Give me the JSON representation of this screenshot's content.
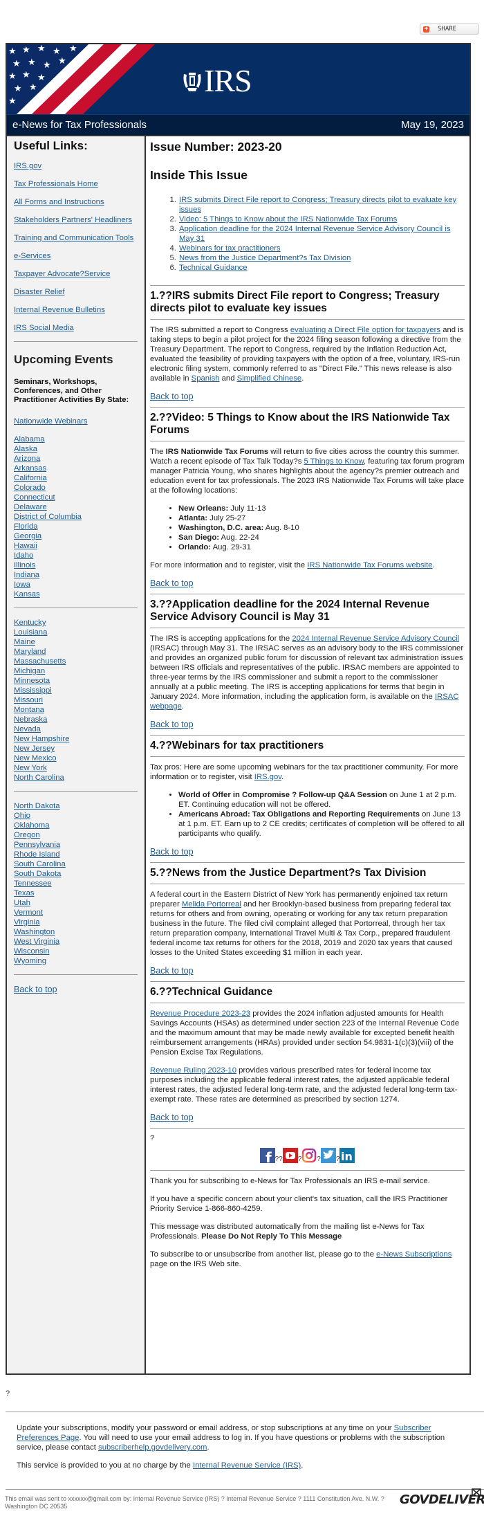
{
  "share": {
    "label": "SHARE"
  },
  "header": {
    "logo_text": "IRS",
    "newsletter_title": "e-News for Tax Professionals",
    "date": "May 19, 2023"
  },
  "sidebar": {
    "useful_links_heading": "Useful Links:",
    "useful_links": [
      {
        "label": "IRS.gov"
      },
      {
        "label": "Tax Professionals Home"
      },
      {
        "label": "All Forms and Instructions"
      },
      {
        "label": "Stakeholders Partners' Headliners"
      },
      {
        "label": "Training and Communication Tools"
      },
      {
        "label": "e-Services"
      },
      {
        "label": "Taxpayer Advocate?Service"
      },
      {
        "label": "Disaster Relief"
      },
      {
        "label": "Internal Revenue Bulletins"
      },
      {
        "label": "IRS Social Media"
      }
    ],
    "events_heading": "Upcoming Events",
    "events_subheading": "Seminars, Workshops, Conferences, and Other Practitioner Activities By State:",
    "nationwide_label": "Nationwide Webinars",
    "states_group_1": [
      "Alabama",
      "Alaska",
      "Arizona",
      "Arkansas",
      "California",
      "Colorado",
      "Connecticut",
      "Delaware",
      "District of Columbia",
      "Florida",
      "Georgia",
      "Hawaii",
      "Idaho",
      "Illinois",
      "Indiana",
      "Iowa",
      "Kansas"
    ],
    "states_group_2": [
      "Kentucky",
      "Louisiana",
      "Maine",
      "Maryland",
      "Massachusetts",
      "Michigan",
      "Minnesota",
      "Mississippi",
      "Missouri",
      "Montana",
      "Nebraska",
      "Nevada",
      "New Hampshire",
      "New Jersey",
      "New Mexico",
      "New York",
      "North Carolina"
    ],
    "states_group_3": [
      "North Dakota",
      "Ohio",
      "Oklahoma",
      "Oregon",
      "Pennsylvania",
      "Rhode Island",
      "South Carolina",
      "South Dakota",
      "Tennessee",
      "Texas",
      "Utah",
      "Vermont",
      "Virginia",
      "Washington",
      "West Virginia",
      "Wisconsin",
      "Wyoming"
    ],
    "back_to_top": "Back to top"
  },
  "main": {
    "issue_number": "Issue Number: 2023-20",
    "inside_heading": "Inside This Issue",
    "toc": [
      "IRS submits Direct File report to Congress; Treasury directs pilot to evaluate key issues",
      "Video: 5 Things to Know about the IRS Nationwide Tax Forums",
      "Application deadline for the 2024 Internal Revenue Service Advisory Council is May 31",
      "Webinars for tax practitioners",
      "News from the Justice Department?s Tax Division",
      "Technical Guidance"
    ],
    "back_to_top": "Back to top",
    "s1": {
      "heading": "1.??IRS submits Direct File report to Congress; Treasury directs pilot to evaluate key issues",
      "t1": "The IRS submitted a report to Congress ",
      "link1": "evaluating a Direct File option for taxpayers",
      "t2": " and is taking steps to begin a pilot project for the 2024 filing season following a directive from the Treasury Department. The report to Congress, required by the Inflation Reduction Act, evaluated the feasibility of providing taxpayers with the option of a free, voluntary, IRS-run electronic filing system, commonly referred to as \"Direct File.\" This news release is also available in ",
      "link2": "Spanish",
      "t3": " and ",
      "link3": "Simplified Chinese",
      "t4": "."
    },
    "s2": {
      "heading": "2.??Video: 5 Things to Know about the IRS Nationwide Tax Forums",
      "t1": "The ",
      "b1": "IRS Nationwide Tax Forums",
      "t2": " will return to five cities across the country this summer. Watch a recent episode of Tax Talk Today?s ",
      "link1": "5 Things to Know",
      "t3": ", featuring tax forum program manager Patricia Young, who shares highlights about the agency?s premier outreach and education event for tax professionals. The 2023 IRS Nationwide Tax Forums will take place at the following locations:",
      "locations": [
        {
          "city": "New Orleans:",
          "dates": " July 11-13"
        },
        {
          "city": "Atlanta:",
          "dates": " July 25-27"
        },
        {
          "city": "Washington, D.C. area:",
          "dates": " Aug. 8-10"
        },
        {
          "city": "San Diego:",
          "dates": " Aug. 22-24"
        },
        {
          "city": "Orlando:",
          "dates": " Aug. 29-31"
        }
      ],
      "more_t1": "For more information and to register, visit the ",
      "more_link": "IRS Nationwide Tax Forums website",
      "more_t2": "."
    },
    "s3": {
      "heading": "3.??Application deadline for the 2024 Internal Revenue Service Advisory Council is May 31",
      "t1": "The IRS is accepting applications for the ",
      "link1": "2024 Internal Revenue Service Advisory Council",
      "t2": " (IRSAC) through May 31. The IRSAC serves as an advisory body to the IRS commissioner and provides an organized public forum for discussion of relevant tax administration issues between IRS officials and representatives of the public. IRSAC members are appointed to three-year terms by the IRS commissioner and submit a report to the commissioner annually at a public meeting. The IRS is accepting applications for terms that begin in January 2024. More information, including the application form, is available on the ",
      "link2": "IRSAC webpage",
      "t3": "."
    },
    "s4": {
      "heading": "4.??Webinars for tax practitioners",
      "t1": "Tax pros: Here are some upcoming webinars for the tax practitioner community. For more information or to register, visit ",
      "link1": "IRS.gov",
      "t2": ".",
      "webinars": [
        {
          "title": "World of Offer in Compromise ? Follow-up Q&A Session",
          "detail": " on June 1 at 2 p.m. ET. Continuing education will not be offered."
        },
        {
          "title": "Americans Abroad: Tax Obligations and Reporting Requirements",
          "detail": " on June 13 at 1 p.m. ET. Earn up to 2 CE credits; certificates of completion will be offered to all participants who qualify."
        }
      ]
    },
    "s5": {
      "heading": "5.??News from the Justice Department?s Tax Division",
      "t1": "A federal court in the Eastern District of New York has permanently enjoined tax return preparer ",
      "link1": "Melida Portorreal",
      "t2": " and her Brooklyn-based business from preparing federal tax returns for others and from owning, operating or working for any tax return preparation business in the future. The filed civil complaint alleged that Portorreal, through her tax return preparation company, International Travel Multi & Tax Corp., prepared fraudulent federal income tax returns for others for the 2018, 2019 and 2020 tax years that caused losses to the United States exceeding $1 million in each year."
    },
    "s6": {
      "heading": "6.??Technical Guidance",
      "p1_link": "Revenue Procedure 2023-23",
      "p1_text": " provides the 2024 inflation adjusted amounts for Health Savings Accounts (HSAs) as determined under section 223 of the Internal Revenue Code and the maximum amount that may be made newly available for excepted benefit health reimbursement arrangements (HRAs) provided under section 54.9831-1(c)(3)(viii) of the Pension Excise Tax Regulations.",
      "p2_link": "Revenue Ruling 2023-10",
      "p2_text": " provides various prescribed rates for federal income tax purposes including the applicable federal interest rates, the adjusted applicable federal interest rates, the adjusted federal long-term rate, and the adjusted federal long-term tax-exempt rate. These rates are determined as prescribed by section 1274."
    },
    "question_mark": "?",
    "social": {
      "icons": [
        "facebook-icon",
        "youtube-icon",
        "instagram-icon",
        "twitter-icon",
        "linkedin-icon"
      ],
      "separators": [
        "??",
        "?",
        "?",
        "?"
      ]
    },
    "footer": {
      "thanks": "Thank you for subscribing to e-News for Tax Professionals an IRS e-mail service.",
      "concern": "If you have a specific concern about your client's tax situation, call the IRS Practitioner Priority Service 1-866-860-4259.",
      "auto_t1": "This message was distributed automatically from the mailing list e-News for Tax Professionals. ",
      "auto_bold": "Please Do Not Reply To This Message",
      "sub_t1": "To subscribe to or unsubscribe from another list, please go to the ",
      "sub_link": "e-News Subscriptions",
      "sub_t2": " page on the IRS Web site."
    }
  },
  "bottom": {
    "question_mark": "?",
    "update_t1": "Update your subscriptions, modify your password or email address, or stop subscriptions at any time on your ",
    "update_link": "Subscriber Preferences Page",
    "update_t2": ". You will need to use your email address to log in. If you have questions or problems with the subscription service, please contact ",
    "help_link": "subscriberhelp.govdelivery.com",
    "update_t3": ".",
    "service_t1": "This service is provided to you at no charge by the ",
    "service_link": "Internal Revenue Service (IRS)",
    "service_t2": ".",
    "legal": "This email was sent to xxxxxx@gmail.com by: Internal Revenue Service (IRS) ? Internal Revenue Service ? 1111 Constitution Ave. N.W. ? Washington DC 20535",
    "brand": "GOVDELIVERY"
  }
}
